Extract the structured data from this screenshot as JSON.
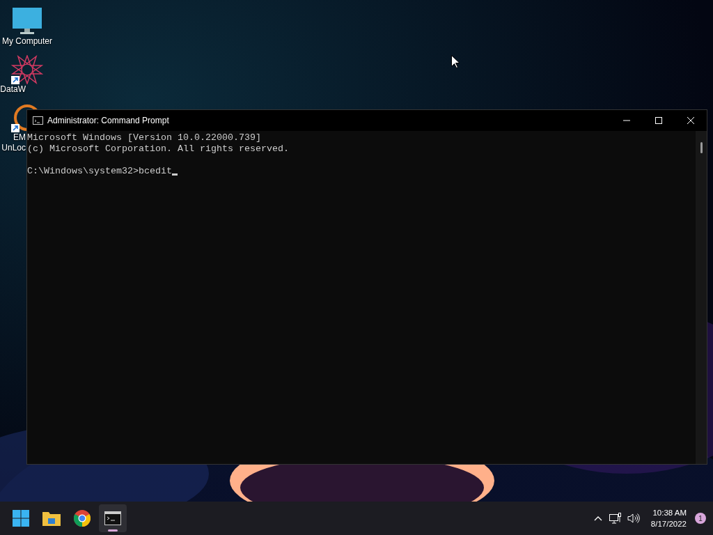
{
  "desktop_icons": [
    {
      "kind": "computer",
      "lines": [
        "My Computer"
      ],
      "shortcut": false
    },
    {
      "kind": "star",
      "lines": [
        "DataW"
      ],
      "shortcut": true
    },
    {
      "kind": "ring",
      "lines": [
        "EM",
        "UnLoc"
      ],
      "shortcut": true
    }
  ],
  "window": {
    "title": "Administrator: Command Prompt",
    "console_lines": [
      "Microsoft Windows [Version 10.0.22000.739]",
      "(c) Microsoft Corporation. All rights reserved."
    ],
    "prompt": "C:\\Windows\\system32>bcedit"
  },
  "taskbar": {
    "apps": [
      {
        "kind": "start",
        "selected": false
      },
      {
        "kind": "folder",
        "selected": false
      },
      {
        "kind": "chrome",
        "selected": false
      },
      {
        "kind": "terminal",
        "selected": true
      }
    ],
    "time": "10:38 AM",
    "date": "8/17/2022",
    "notification_count": "1"
  }
}
